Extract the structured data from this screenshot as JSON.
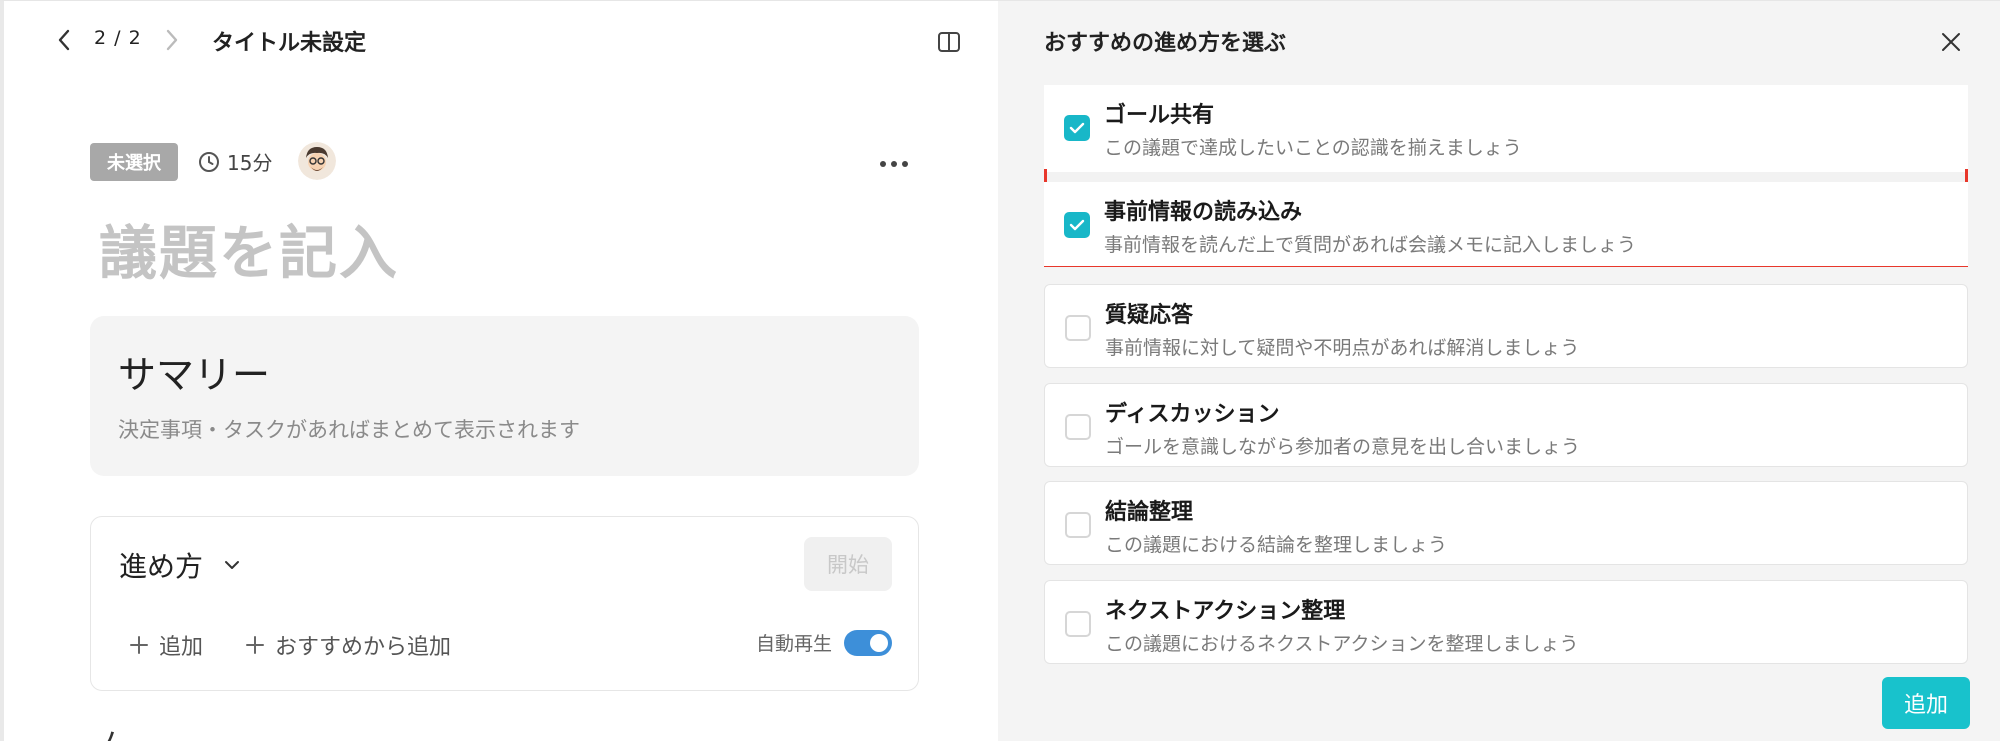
{
  "header": {
    "pager": "2 / 2",
    "title": "タイトル未設定"
  },
  "agenda": {
    "status_badge": "未選択",
    "duration": "15分",
    "title_placeholder": "議題を記入"
  },
  "summary": {
    "title": "サマリー",
    "description": "決定事項・タスクがあればまとめて表示されます"
  },
  "steps": {
    "title": "進め方",
    "start_label": "開始",
    "add_label": "追加",
    "add_recommended_label": "おすすめから追加",
    "autoplay_label": "自動再生",
    "autoplay_on": true
  },
  "next_section_partial": "ノ",
  "recommend_panel": {
    "title": "おすすめの進め方を選ぶ",
    "options": [
      {
        "title": "ゴール共有",
        "description": "この議題で達成したいことの認識を揃えましょう",
        "checked": true
      },
      {
        "title": "事前情報の読み込み",
        "description": "事前情報を読んだ上で質問があれば会議メモに記入しましょう",
        "checked": true
      },
      {
        "title": "質疑応答",
        "description": "事前情報に対して疑問や不明点があれば解消しましょう",
        "checked": false
      },
      {
        "title": "ディスカッション",
        "description": "ゴールを意識しながら参加者の意見を出し合いましょう",
        "checked": false
      },
      {
        "title": "結論整理",
        "description": "この議題における結論を整理しましょう",
        "checked": false
      },
      {
        "title": "ネクストアクション整理",
        "description": "この議題におけるネクストアクションを整理しましょう",
        "checked": false
      }
    ],
    "add_button_label": "追加"
  },
  "colors": {
    "accent": "#18b7c8",
    "highlight_border": "#e8372b",
    "toggle": "#3d8fd9"
  }
}
